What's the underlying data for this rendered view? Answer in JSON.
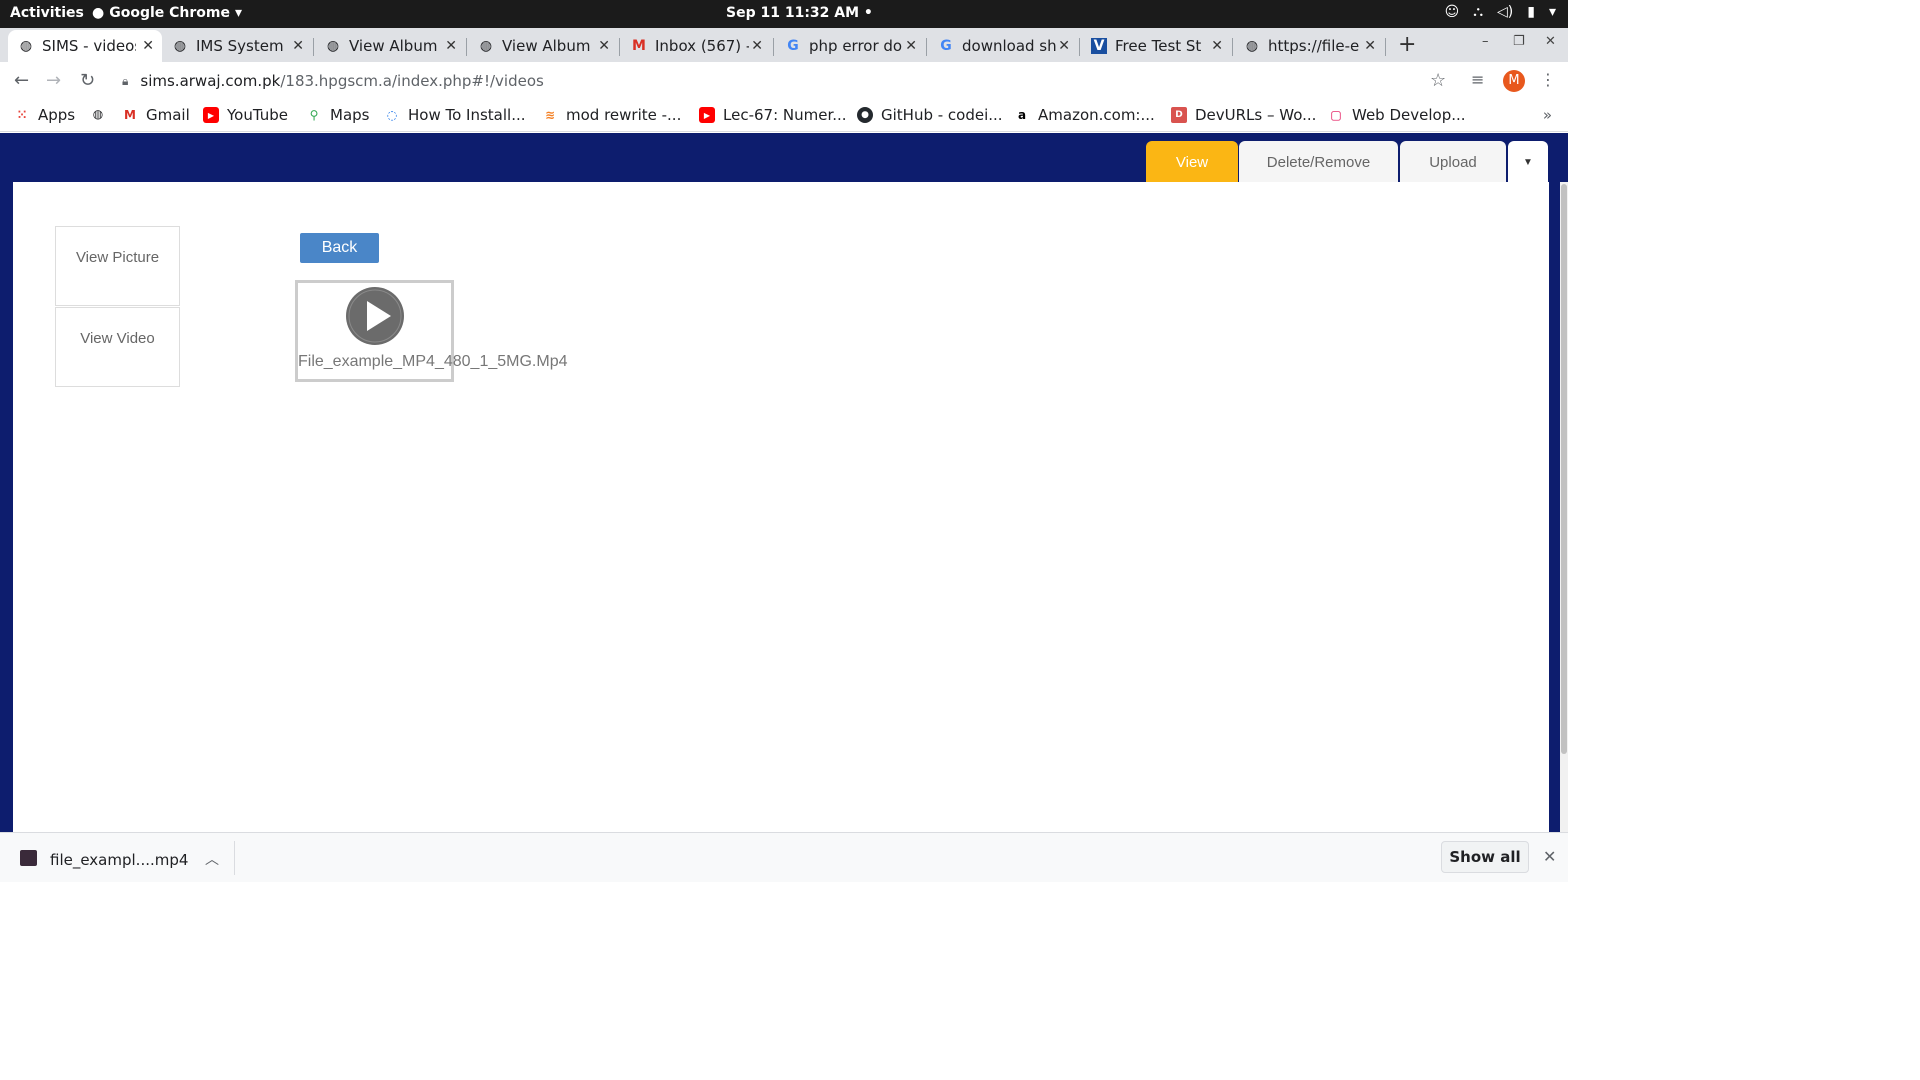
{
  "system_bar": {
    "activities": "Activities",
    "app_name": "Google Chrome",
    "clock": "Sep 11  11:32 AM"
  },
  "tabs": [
    {
      "title": "SIMS - videos",
      "icon": "globe-icon",
      "active": true
    },
    {
      "title": "IMS System",
      "icon": "globe-icon"
    },
    {
      "title": "View Album",
      "icon": "globe-icon"
    },
    {
      "title": "View Album",
      "icon": "globe-icon"
    },
    {
      "title": "Inbox (567) -",
      "icon": "gmail-icon"
    },
    {
      "title": "php error do",
      "icon": "google-icon"
    },
    {
      "title": "download sh",
      "icon": "google-icon"
    },
    {
      "title": "Free Test St",
      "icon": "v-icon"
    },
    {
      "title": "https://file-e",
      "icon": "globe-icon"
    }
  ],
  "omnibox": {
    "host": "sims.arwaj.com.pk",
    "path": "/183.hpgscm.a/index.php#!/videos"
  },
  "profile_initial": "M",
  "bookmarks": [
    {
      "label": "Apps",
      "icon": "apps-grid-icon"
    },
    {
      "label": "",
      "icon": "globe-icon"
    },
    {
      "label": "Gmail",
      "icon": "gmail-icon"
    },
    {
      "label": "YouTube",
      "icon": "youtube-icon"
    },
    {
      "label": "Maps",
      "icon": "maps-icon"
    },
    {
      "label": "How To Install...",
      "icon": "spinner-icon"
    },
    {
      "label": "mod rewrite -...",
      "icon": "stackoverflow-icon"
    },
    {
      "label": "Lec-67: Numer...",
      "icon": "youtube-icon"
    },
    {
      "label": "GitHub - codei...",
      "icon": "github-icon"
    },
    {
      "label": "Amazon.com:...",
      "icon": "amazon-icon"
    },
    {
      "label": "DevURLs – Wo...",
      "icon": "devurls-icon"
    },
    {
      "label": "Web Develop...",
      "icon": "web-icon"
    }
  ],
  "nav": {
    "view": "View",
    "delete": "Delete/Remove",
    "upload": "Upload"
  },
  "sidebar": {
    "view_picture": "View Picture",
    "view_video": "View Video"
  },
  "main": {
    "back": "Back",
    "video_filename": "File_example_MP4_480_1_5MG.Mp4"
  },
  "downloads": {
    "file": "file_exampl....mp4",
    "show_all": "Show all"
  },
  "colors": {
    "page_bg": "#0d1d6e",
    "active_nav": "#fbb614",
    "back_button": "#4a86c8"
  }
}
